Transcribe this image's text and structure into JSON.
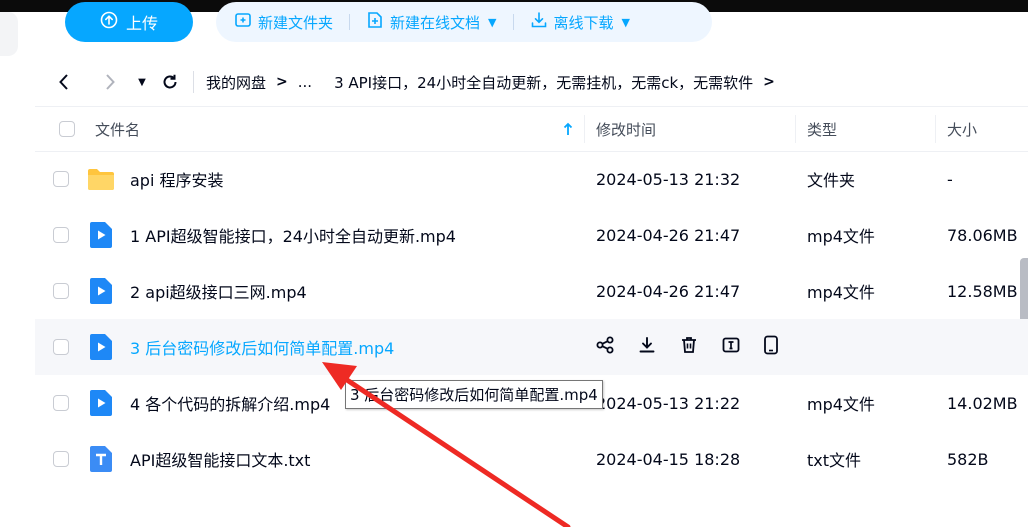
{
  "colors": {
    "accent": "#06a7ff",
    "annotation_arrow": "#ee2a24",
    "video_icon": "#1e88f6",
    "folder_icon": "#ffc53d"
  },
  "toolbar": {
    "upload_label": "上传",
    "new_folder_label": "新建文件夹",
    "new_online_doc_label": "新建在线文档",
    "offline_download_label": "离线下载"
  },
  "breadcrumb": {
    "root": "我的网盘",
    "ellipsis": "...",
    "current": "3 API接口，24小时全自动更新，无需挂机，无需ck，无需软件"
  },
  "columns": {
    "name": "文件名",
    "modified": "修改时间",
    "type": "类型",
    "size": "大小"
  },
  "files": [
    {
      "name": "api  程序安装",
      "modified": "2024-05-13 21:32",
      "type": "文件夹",
      "size": "-",
      "icon": "folder-icon"
    },
    {
      "name": "1 API超级智能接口，24小时全自动更新.mp4",
      "modified": "2024-04-26 21:47",
      "type": "mp4文件",
      "size": "78.06MB",
      "icon": "video-file-icon"
    },
    {
      "name": "2 api超级接口三网.mp4",
      "modified": "2024-04-26 21:47",
      "type": "mp4文件",
      "size": "12.58MB",
      "icon": "video-file-icon"
    },
    {
      "name": "3 后台密码修改后如何简单配置.mp4",
      "icon": "video-file-icon",
      "hovered": true
    },
    {
      "name": "4 各个代码的拆解介绍.mp4",
      "modified": "2024-05-13 21:22",
      "type": "mp4文件",
      "size": "14.02MB",
      "icon": "video-file-icon"
    },
    {
      "name": "API超级智能接口文本.txt",
      "modified": "2024-04-15 18:28",
      "type": "txt文件",
      "size": "582B",
      "icon": "text-file-icon"
    }
  ],
  "tooltip": {
    "text": "3 后台密码修改后如何简单配置.mp4"
  }
}
